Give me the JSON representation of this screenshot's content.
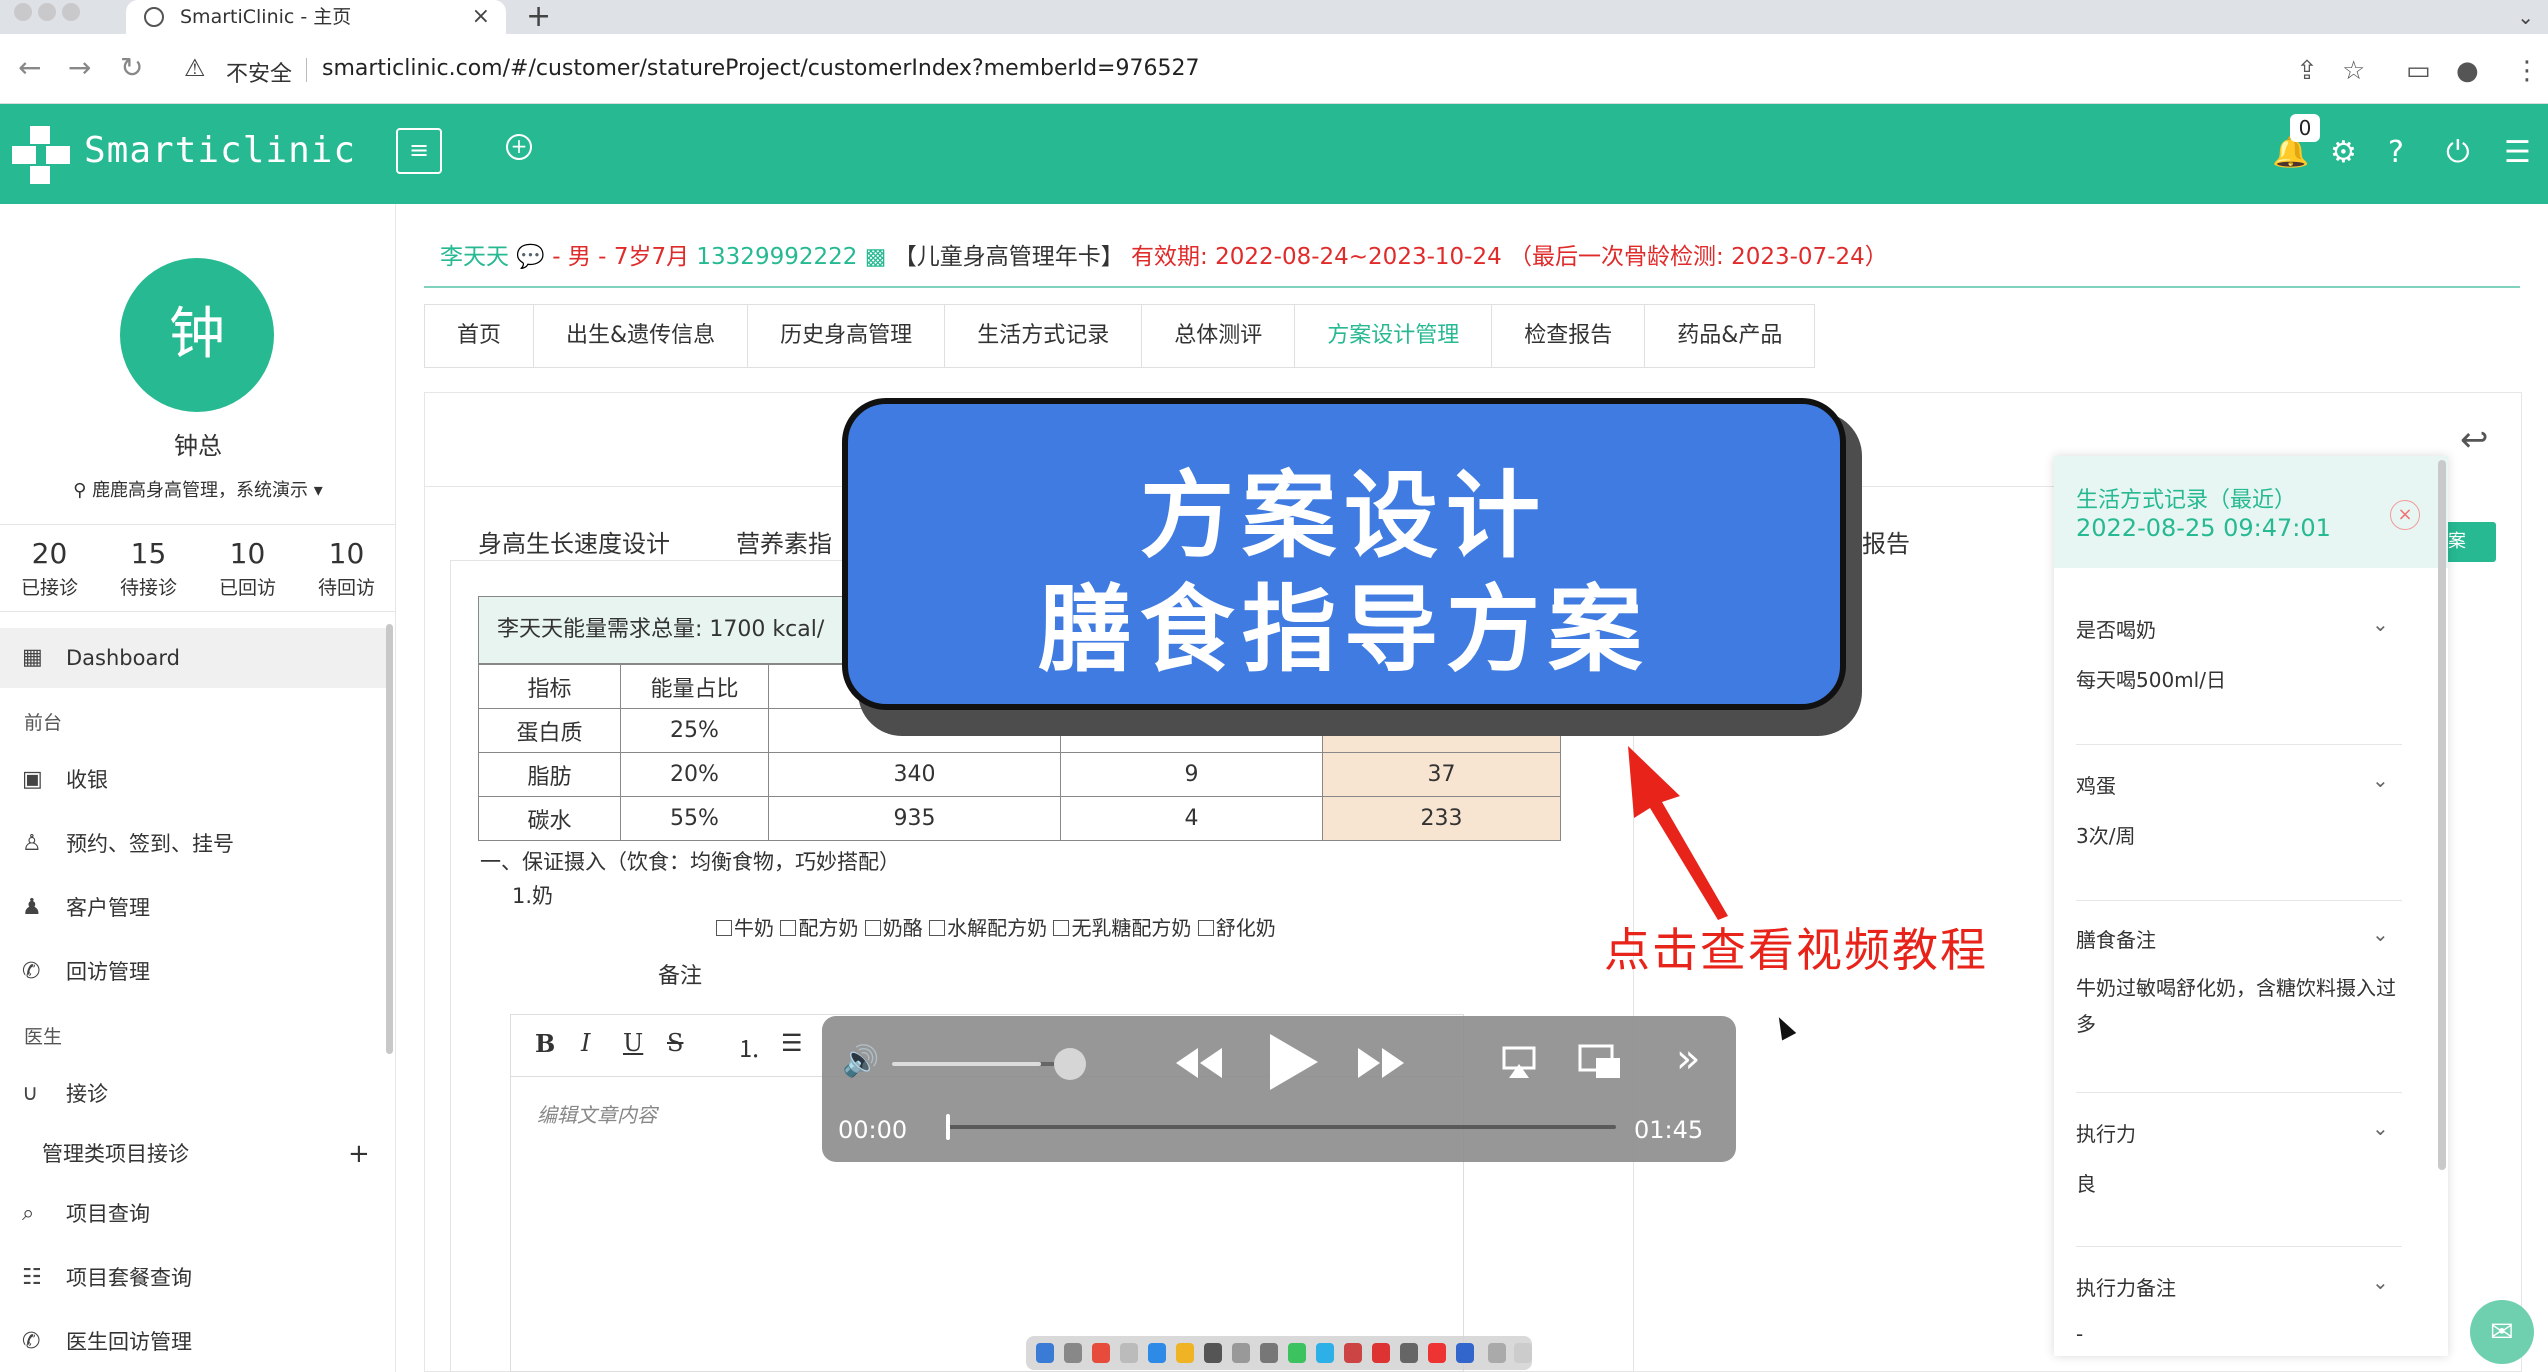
{
  "browser": {
    "tab_title": "SmartiClinic - 主页",
    "tab_close": "×",
    "new_tab": "+",
    "insecure_label": "不安全",
    "url": "smarticlinic.com/#/customer/statureProject/customerIndex?memberId=976527"
  },
  "header": {
    "brand": "Smarticlinic",
    "notification_count": "0"
  },
  "sidebar": {
    "avatar_char": "钟",
    "user_name": "钟总",
    "location": "鹿鹿高身高管理，系统演示",
    "stats": [
      {
        "value": "20",
        "label": "已接诊"
      },
      {
        "value": "15",
        "label": "待接诊"
      },
      {
        "value": "10",
        "label": "已回访"
      },
      {
        "value": "10",
        "label": "待回访"
      }
    ],
    "items": {
      "dashboard": "Dashboard",
      "group_front": "前台",
      "cashier": "收银",
      "appointment": "预约、签到、挂号",
      "customer": "客户管理",
      "followup": "回访管理",
      "group_doctor": "医生",
      "reception": "接诊",
      "project_reception": "管理类项目接诊",
      "project_query": "项目查询",
      "package_query": "项目套餐查询",
      "doctor_followup": "医生回访管理"
    }
  },
  "patient": {
    "name": "李天天",
    "gender": "- 男 -",
    "age": "7岁7月",
    "phone": "13329992222",
    "card": "【儿童身高管理年卡】",
    "validity_label": "有效期:",
    "validity": "2022-08-24~2023-10-24",
    "last_bone_label": "（最后一次骨龄检测:",
    "last_bone": "2023-07-24）"
  },
  "tabs": [
    "首页",
    "出生&遗传信息",
    "历史身高管理",
    "生活方式记录",
    "总体测评",
    "方案设计管理",
    "检查报告",
    "药品&产品"
  ],
  "subtabs": {
    "growth_speed": "身高生长速度设计",
    "nutrition": "营养素指",
    "report": "报告"
  },
  "nutrition": {
    "energy_label": "李天天能量需求总量: 1700 kcal/",
    "header": [
      "指标",
      "能量占比"
    ],
    "rows": [
      {
        "name": "蛋白质",
        "ratio": "25%",
        "kcal": "",
        "factor": "",
        "grams": ""
      },
      {
        "name": "脂肪",
        "ratio": "20%",
        "kcal": "340",
        "factor": "9",
        "grams": "37"
      },
      {
        "name": "碳水",
        "ratio": "55%",
        "kcal": "935",
        "factor": "4",
        "grams": "233"
      }
    ],
    "guide_title": "一、保证摄入（饮食：均衡食物，巧妙搭配）",
    "guide_milk": "1.奶",
    "milk_options": [
      "牛奶",
      "配方奶",
      "奶酪",
      "水解配方奶",
      "无乳糖配方奶",
      "舒化奶"
    ],
    "note_label": "备注",
    "editor_placeholder": "编辑文章内容"
  },
  "editor_toolbar": {
    "bold": "B",
    "italic": "I",
    "underline": "U",
    "strike": "S"
  },
  "overlay": {
    "line1": "方案设计",
    "line2": "膳食指导方案",
    "caption": "点击查看视频教程"
  },
  "player": {
    "current_time": "00:00",
    "duration": "01:45",
    "progress": 0,
    "volume": 0.83
  },
  "lifestyle": {
    "title": "生活方式记录（最近）",
    "time": "2022-08-25 09:47:01",
    "close": "×",
    "sections": [
      {
        "label": "是否喝奶",
        "value": "每天喝500ml/日"
      },
      {
        "label": "鸡蛋",
        "value": "3次/周"
      },
      {
        "label": "膳食备注",
        "value": "牛奶过敏喝舒化奶，含糖饮料摄入过多"
      },
      {
        "label": "执行力",
        "value": "良"
      },
      {
        "label": "执行力备注",
        "value": "-"
      }
    ]
  },
  "colors": {
    "brand": "#26b992",
    "banner": "#3f7be0",
    "caption": "#e8231a",
    "patient_red": "#e02b2b"
  }
}
